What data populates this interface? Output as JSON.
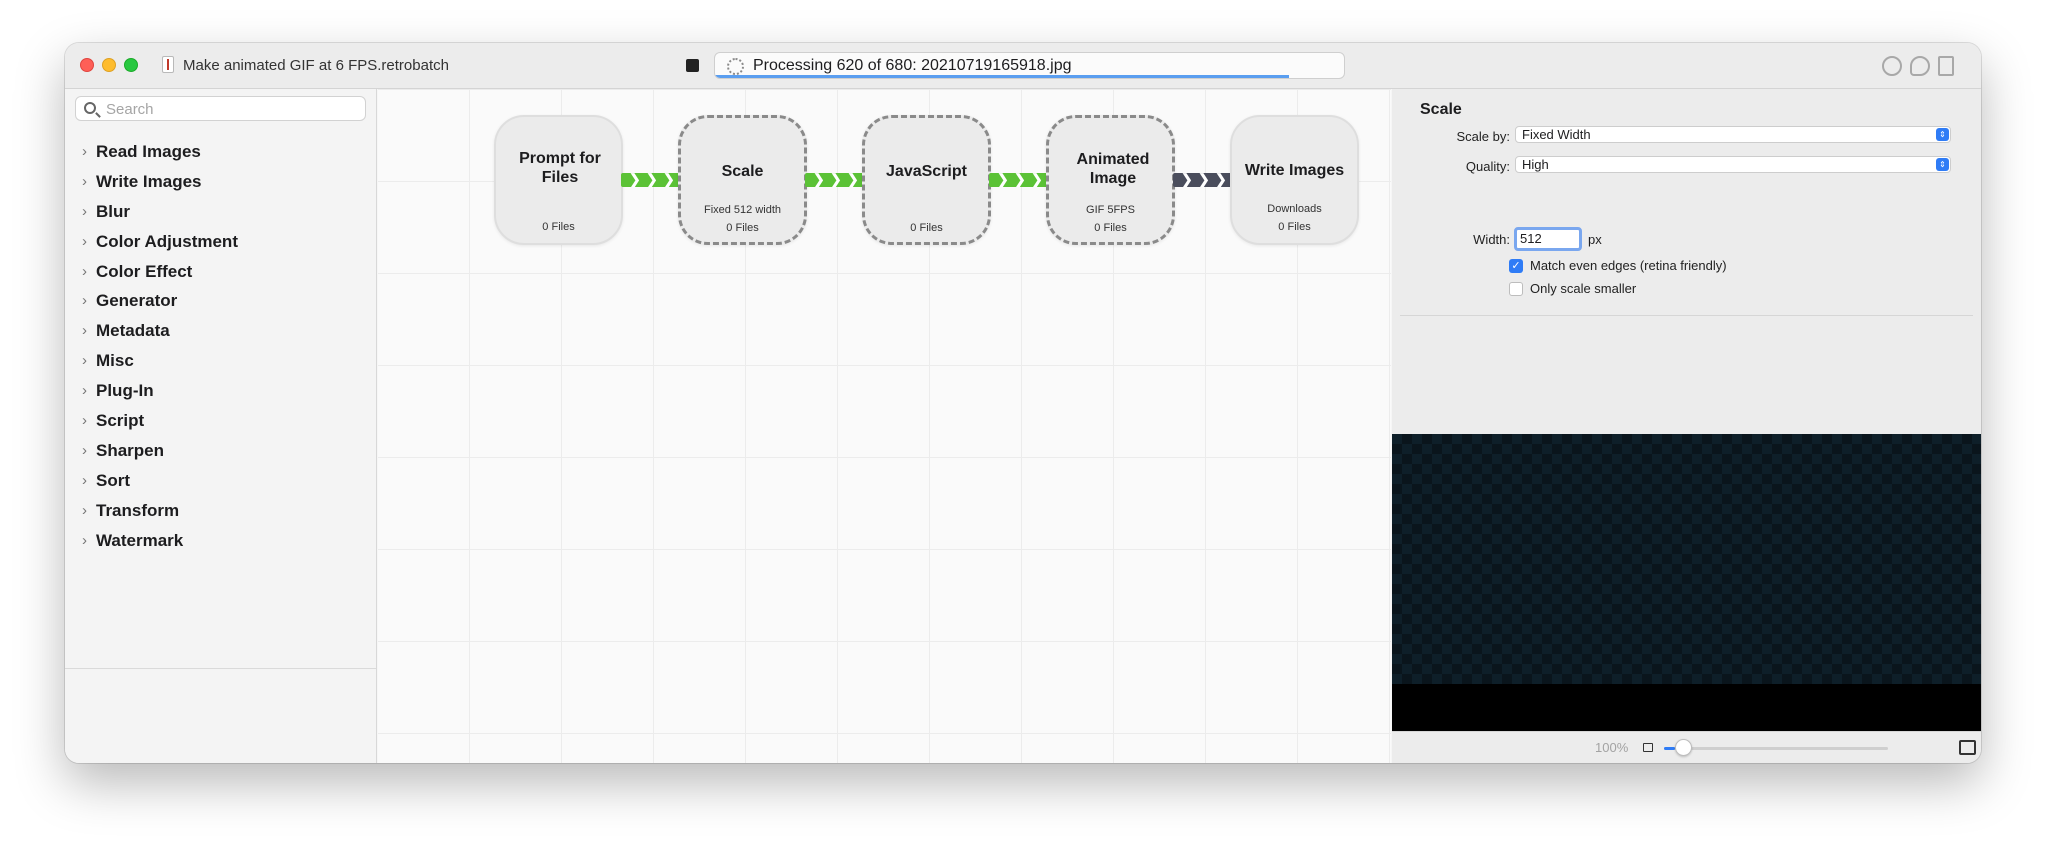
{
  "window": {
    "title": "Make animated GIF at 6 FPS.retrobatch"
  },
  "toolbar": {
    "progress_text": "Processing 620 of 680: 20210719165918.jpg",
    "progress_fraction": 0.912
  },
  "sidebar": {
    "search_placeholder": "Search",
    "categories": [
      "Read Images",
      "Write Images",
      "Blur",
      "Color Adjustment",
      "Color Effect",
      "Generator",
      "Metadata",
      "Misc",
      "Plug-In",
      "Script",
      "Sharpen",
      "Sort",
      "Transform",
      "Watermark"
    ]
  },
  "workflow": {
    "nodes": [
      {
        "title": "Prompt for Files",
        "subtitle": "",
        "files": "0 Files"
      },
      {
        "title": "Scale",
        "subtitle": "Fixed 512 width",
        "files": "0 Files"
      },
      {
        "title": "JavaScript",
        "subtitle": "",
        "files": "0 Files"
      },
      {
        "title": "Animated Image",
        "subtitle": "GIF 5FPS",
        "files": "0 Files"
      },
      {
        "title": "Write Images",
        "subtitle": "Downloads",
        "files": "0 Files"
      }
    ]
  },
  "inspector": {
    "title": "Scale",
    "enabled": true,
    "scale_by_label": "Scale by:",
    "scale_by_value": "Fixed Width",
    "quality_label": "Quality:",
    "quality_value": "High",
    "width_label": "Width:",
    "width_value": "512",
    "width_unit": "px",
    "match_even_label": "Match even edges (retina friendly)",
    "match_even_checked": true,
    "only_smaller_label": "Only scale smaller",
    "only_smaller_checked": false
  },
  "preview": {
    "zoom": "100%",
    "zoom_fraction": 0.05
  },
  "colors": {
    "accent": "#2f7cf6",
    "connector_green": "#5bc236",
    "connector_gray": "#4a4d5c"
  }
}
